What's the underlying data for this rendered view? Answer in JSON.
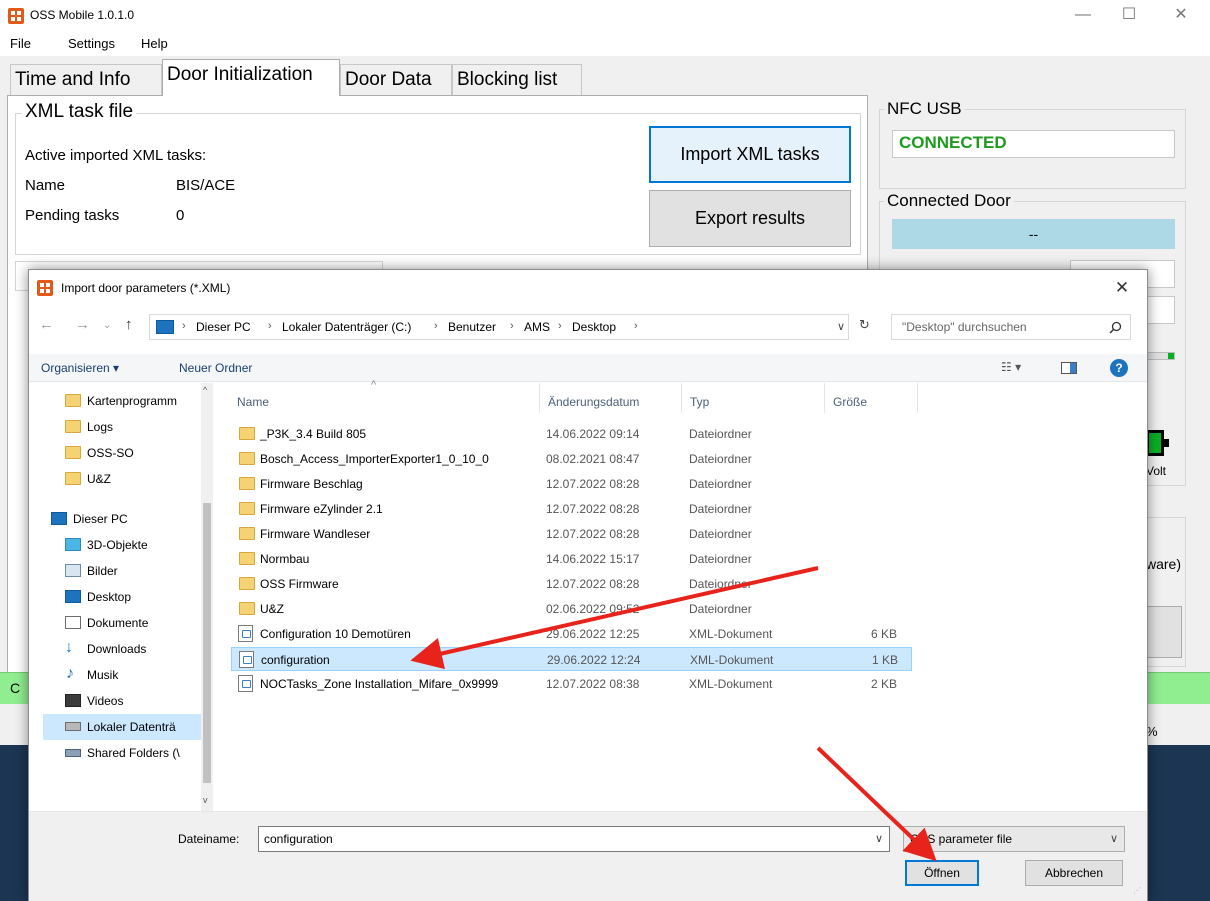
{
  "app": {
    "title": "OSS Mobile 1.0.1.0",
    "menus": [
      "File",
      "Settings",
      "Help"
    ],
    "tabs": [
      "Time and Info",
      "Door Initialization",
      "Door Data",
      "Blocking list"
    ],
    "xml_group": {
      "title": "XML task file",
      "active_label": "Active imported XML tasks:",
      "name_label": "Name",
      "name_value": "BIS/ACE",
      "pending_label": "Pending tasks",
      "pending_value": "0",
      "import_button": "Import XML tasks",
      "export_button": "Export results"
    },
    "nfc": {
      "title": "NFC USB",
      "status": "CONNECTED"
    },
    "door": {
      "title": "Connected Door",
      "value": "--"
    },
    "volt": "Volt",
    "partial_right_text": "ware)",
    "partial_status_text": "C",
    "percent": "%"
  },
  "dialog": {
    "title": "Import door parameters (*.XML)",
    "breadcrumb": [
      "Dieser PC",
      "Lokaler Datenträger (C:)",
      "Benutzer",
      "AMS",
      "Desktop"
    ],
    "search_placeholder": "\"Desktop\" durchsuchen",
    "organize": "Organisieren",
    "new_folder": "Neuer Ordner",
    "nav_items": [
      {
        "label": "Kartenprogramm",
        "icon": "folder-icon"
      },
      {
        "label": "Logs",
        "icon": "folder-icon"
      },
      {
        "label": "OSS-SO",
        "icon": "folder-icon"
      },
      {
        "label": "U&Z",
        "icon": "folder-icon"
      },
      {
        "label": "Dieser PC",
        "icon": "computer-icon"
      },
      {
        "label": "3D-Objekte",
        "icon": "3d-objects-icon"
      },
      {
        "label": "Bilder",
        "icon": "pictures-icon"
      },
      {
        "label": "Desktop",
        "icon": "desktop-icon"
      },
      {
        "label": "Dokumente",
        "icon": "documents-icon"
      },
      {
        "label": "Downloads",
        "icon": "downloads-icon"
      },
      {
        "label": "Musik",
        "icon": "music-icon"
      },
      {
        "label": "Videos",
        "icon": "videos-icon"
      },
      {
        "label": "Lokaler Datenträ",
        "icon": "drive-icon"
      },
      {
        "label": "Shared Folders (\\",
        "icon": "network-drive-icon"
      }
    ],
    "columns": [
      "Name",
      "Änderungsdatum",
      "Typ",
      "Größe"
    ],
    "files": [
      {
        "name": "_P3K_3.4 Build 805",
        "date": "14.06.2022 09:14",
        "type": "Dateiordner",
        "size": "",
        "kind": "folder"
      },
      {
        "name": "Bosch_Access_ImporterExporter1_0_10_0",
        "date": "08.02.2021 08:47",
        "type": "Dateiordner",
        "size": "",
        "kind": "folder"
      },
      {
        "name": "Firmware Beschlag",
        "date": "12.07.2022 08:28",
        "type": "Dateiordner",
        "size": "",
        "kind": "folder"
      },
      {
        "name": "Firmware eZylinder 2.1",
        "date": "12.07.2022 08:28",
        "type": "Dateiordner",
        "size": "",
        "kind": "folder"
      },
      {
        "name": "Firmware Wandleser",
        "date": "12.07.2022 08:28",
        "type": "Dateiordner",
        "size": "",
        "kind": "folder"
      },
      {
        "name": "Normbau",
        "date": "14.06.2022 15:17",
        "type": "Dateiordner",
        "size": "",
        "kind": "folder"
      },
      {
        "name": "OSS Firmware",
        "date": "12.07.2022 08:28",
        "type": "Dateiordner",
        "size": "",
        "kind": "folder"
      },
      {
        "name": "U&Z",
        "date": "02.06.2022 09:52",
        "type": "Dateiordner",
        "size": "",
        "kind": "folder"
      },
      {
        "name": "Configuration 10 Demotüren",
        "date": "29.06.2022 12:25",
        "type": "XML-Dokument",
        "size": "6 KB",
        "kind": "xml"
      },
      {
        "name": "configuration",
        "date": "29.06.2022 12:24",
        "type": "XML-Dokument",
        "size": "1 KB",
        "kind": "xml"
      },
      {
        "name": "NOCTasks_Zone Installation_Mifare_0x9999",
        "date": "12.07.2022 08:38",
        "type": "XML-Dokument",
        "size": "2 KB",
        "kind": "xml"
      }
    ],
    "filename_label": "Dateiname:",
    "filename_value": "configuration",
    "filter_value": "OSS parameter file",
    "open_button": "Öffnen",
    "cancel_button": "Abbrechen",
    "annotation_color": "#e8231b"
  }
}
